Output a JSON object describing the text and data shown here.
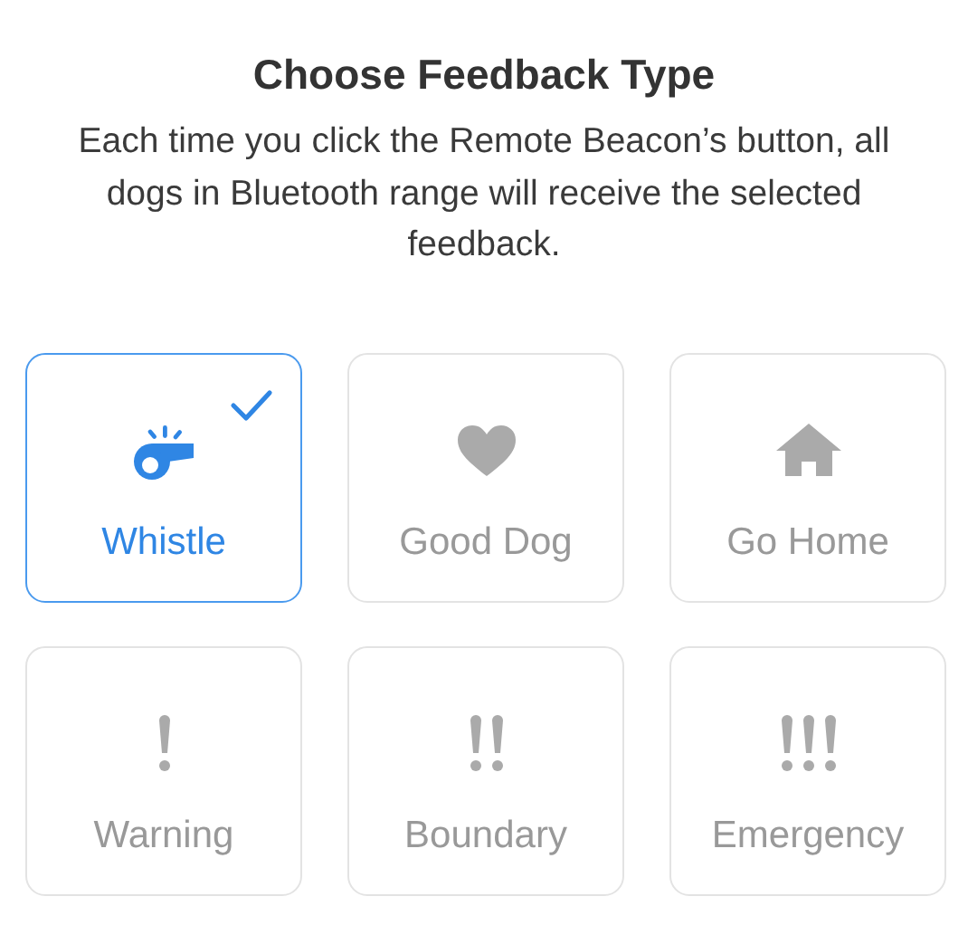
{
  "title": "Choose Feedback Type",
  "description": "Each time you click the Remote Beacon’s button, all dogs in Bluetooth range will receive the selected feedback.",
  "options": [
    {
      "label": "Whistle",
      "kind": "whistle",
      "selected": true
    },
    {
      "label": "Good Dog",
      "kind": "heart",
      "selected": false
    },
    {
      "label": "Go Home",
      "kind": "house",
      "selected": false
    },
    {
      "label": "Warning",
      "kind": "exclaim1",
      "selected": false
    },
    {
      "label": "Boundary",
      "kind": "exclaim2",
      "selected": false
    },
    {
      "label": "Emergency",
      "kind": "exclaim3",
      "selected": false
    }
  ]
}
